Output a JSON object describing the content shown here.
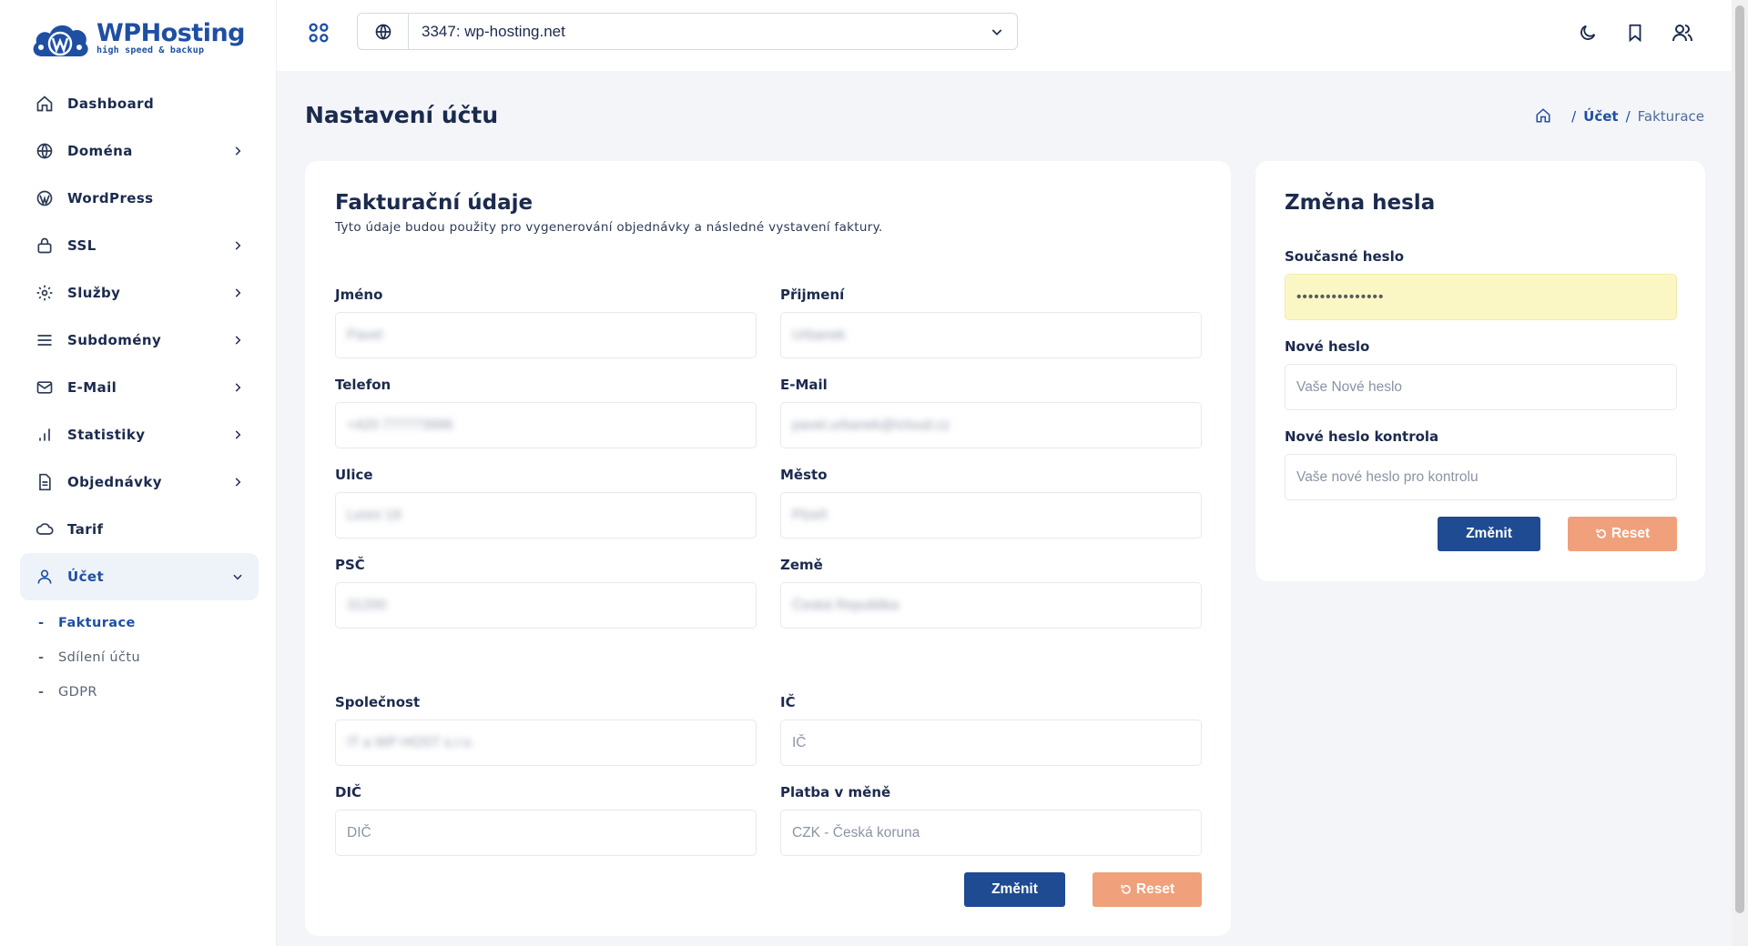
{
  "brand": {
    "title": "WPHosting",
    "subtitle": "high speed & backup"
  },
  "sidebar": {
    "items": [
      {
        "label": "Dashboard",
        "icon": "home-icon"
      },
      {
        "label": "Doména",
        "icon": "globe-icon"
      },
      {
        "label": "WordPress",
        "icon": "wordpress-icon"
      },
      {
        "label": "SSL",
        "icon": "lock-icon"
      },
      {
        "label": "Služby",
        "icon": "gear-icon"
      },
      {
        "label": "Subdomény",
        "icon": "list-icon"
      },
      {
        "label": "E-Mail",
        "icon": "mail-icon"
      },
      {
        "label": "Statistiky",
        "icon": "bar-chart-icon"
      },
      {
        "label": "Objednávky",
        "icon": "document-icon"
      },
      {
        "label": "Tarif",
        "icon": "cloud-icon"
      },
      {
        "label": "Účet",
        "icon": "user-icon"
      }
    ],
    "subitems": [
      {
        "label": "Fakturace"
      },
      {
        "label": "Sdílení účtu"
      },
      {
        "label": "GDPR"
      }
    ],
    "sub_dash": "-"
  },
  "topbar": {
    "domain": "3347: wp-hosting.net"
  },
  "page": {
    "title": "Nastavení účtu",
    "breadcrumb": {
      "sep": "/",
      "link": "Účet",
      "current": "Fakturace"
    }
  },
  "billing": {
    "title": "Fakturační údaje",
    "subtitle": "Tyto údaje budou použity pro vygenerování objednávky a následné vystavení faktury.",
    "fields": {
      "first_name": {
        "label": "Jméno",
        "value": "Pavel"
      },
      "last_name": {
        "label": "Přijmení",
        "value": "Urbanek"
      },
      "phone": {
        "label": "Telefon",
        "value": "+420 777773996"
      },
      "email": {
        "label": "E-Mail",
        "value": "pavel.urbanek@icloud.cz"
      },
      "street": {
        "label": "Ulice",
        "value": "Lesní 19"
      },
      "city": {
        "label": "Město",
        "value": "Plzeň"
      },
      "zip": {
        "label": "PSČ",
        "value": "31200"
      },
      "country": {
        "label": "Země",
        "value": "Česká Republika"
      },
      "company": {
        "label": "Společnost",
        "value": "IT a WP HOST s.r.o."
      },
      "ic": {
        "label": "IČ",
        "placeholder": "IČ"
      },
      "dic": {
        "label": "DIČ",
        "placeholder": "DIČ"
      },
      "currency": {
        "label": "Platba v měně",
        "value": "CZK - Česká koruna"
      }
    },
    "submit_label": "Změnit",
    "reset_label": "Reset"
  },
  "password": {
    "title": "Změna hesla",
    "current": {
      "label": "Současné heslo",
      "value": "•••••••••••••••"
    },
    "new": {
      "label": "Nové heslo",
      "placeholder": "Vaše Nové heslo"
    },
    "confirm": {
      "label": "Nové heslo kontrola",
      "placeholder": "Vaše nové heslo pro kontrolu"
    },
    "submit_label": "Změnit",
    "reset_label": "Reset"
  }
}
